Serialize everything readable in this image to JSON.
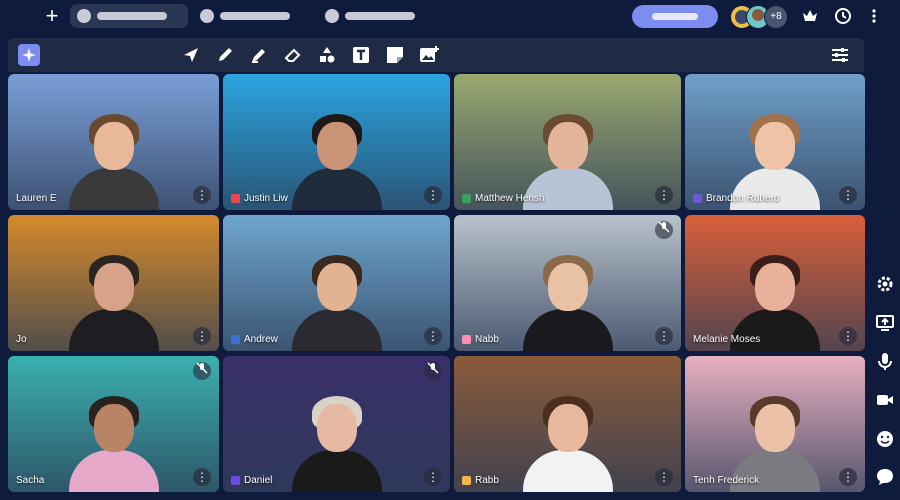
{
  "topbar": {
    "add_icon": "+",
    "tabs": [
      {
        "name": "tab-1",
        "state": "active"
      },
      {
        "name": "tab-2",
        "state": "inactive"
      },
      {
        "name": "tab-3",
        "state": "inactive"
      }
    ],
    "participant_overflow": "+8",
    "icons": [
      "crown-icon",
      "clock-icon",
      "more-vertical-icon"
    ]
  },
  "toolbar": {
    "tools": [
      "brand-logo",
      "arrow-pointer-icon",
      "pen-icon",
      "marker-icon",
      "eraser-icon",
      "shapes-icon",
      "text-icon",
      "sticky-note-icon",
      "add-image-icon",
      "settings-sliders-icon"
    ]
  },
  "participants": [
    {
      "name": "Lauren E",
      "color": "#7a9fd6",
      "swatch": ""
    },
    {
      "name": "Justin Liw",
      "color": "#2aa5e0",
      "swatch": "#e5484d"
    },
    {
      "name": "Matthew Hensh",
      "color": "#9aa870",
      "swatch": "#3b9e5a"
    },
    {
      "name": "Brandon Ruhero",
      "color": "#6fa0c9",
      "swatch": "#6a5acd"
    },
    {
      "name": "Jo",
      "color": "#d48a2a",
      "swatch": ""
    },
    {
      "name": "Andrew",
      "color": "#6fa6cf",
      "swatch": "#3b6fd4"
    },
    {
      "name": "Nabb",
      "color": "#b8c2cc",
      "swatch": "#ff8fb1"
    },
    {
      "name": "Melanie Moses",
      "color": "#d9603a",
      "swatch": ""
    },
    {
      "name": "Sacha",
      "color": "#3ab0b0",
      "swatch": ""
    },
    {
      "name": "Daniel",
      "color": "#3a2f6a",
      "swatch": "#6a4ce0"
    },
    {
      "name": "Rabb",
      "color": "#8a5a3a",
      "swatch": "#f2b84b"
    },
    {
      "name": "Tenh Frederick",
      "color": "#e8b0c0",
      "swatch": ""
    }
  ],
  "rail": {
    "icons": [
      "settings-gear-icon",
      "screen-share-icon",
      "microphone-icon",
      "camera-icon",
      "emoji-icon",
      "chat-icon"
    ]
  },
  "labels": {
    "more": "⋮",
    "mute": "🔇",
    "brand": "✦"
  }
}
